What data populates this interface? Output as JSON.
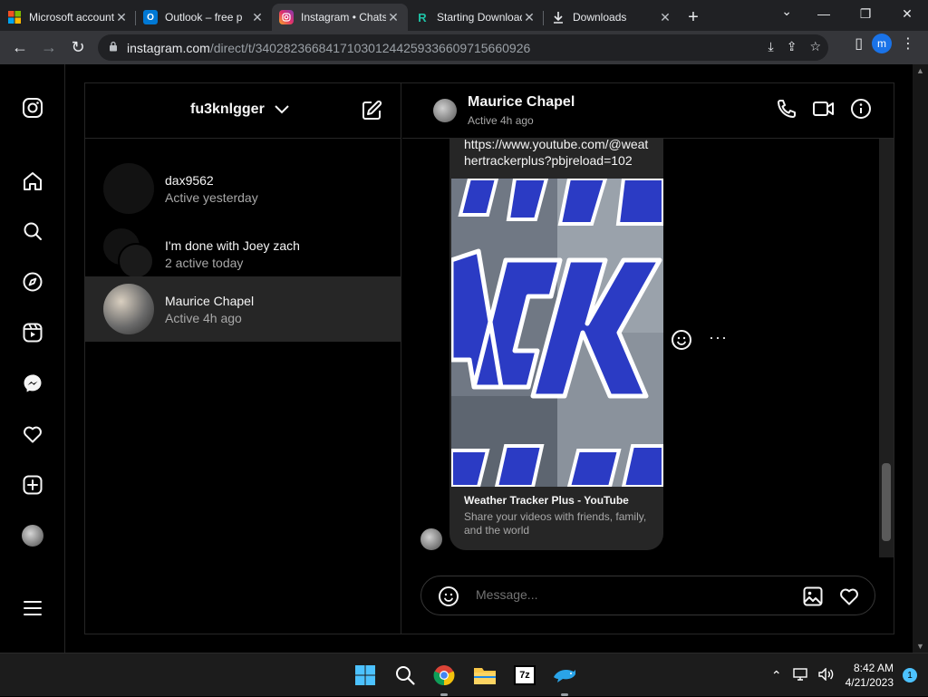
{
  "browser": {
    "tabs": [
      {
        "label": "Microsoft account"
      },
      {
        "label": "Outlook – free p"
      },
      {
        "label": "Instagram • Chats"
      },
      {
        "label": "Starting Download"
      },
      {
        "label": "Downloads"
      }
    ],
    "url_host": "instagram.com",
    "url_path": "/direct/t/340282366841710301244259336609715660926",
    "profile_initial": "m"
  },
  "dm": {
    "account": "fu3knlgger",
    "threads": [
      {
        "name": "dax9562",
        "status": "Active yesterday"
      },
      {
        "name": "I'm done with Joey zach",
        "status": "2 active today"
      },
      {
        "name": "Maurice Chapel",
        "status": "Active 4h ago"
      }
    ]
  },
  "chat": {
    "contact_name": "Maurice Chapel",
    "contact_status": "Active 4h ago",
    "link_text": "https://www.youtube.com/@weathertrackerplus?pbjreload=102",
    "card_title": "Weather Tracker Plus - YouTube",
    "card_description": "Share your videos with friends, family, and the world",
    "message_placeholder": "Message..."
  },
  "taskbar": {
    "time": "8:42 AM",
    "date": "4/21/2023",
    "notification_count": "1"
  },
  "colors": {
    "background": "#000000",
    "panel_border": "#262626",
    "selected_thread": "#262626",
    "bubble": "#262626",
    "thumbnail_blue": "#2b3bc4"
  }
}
